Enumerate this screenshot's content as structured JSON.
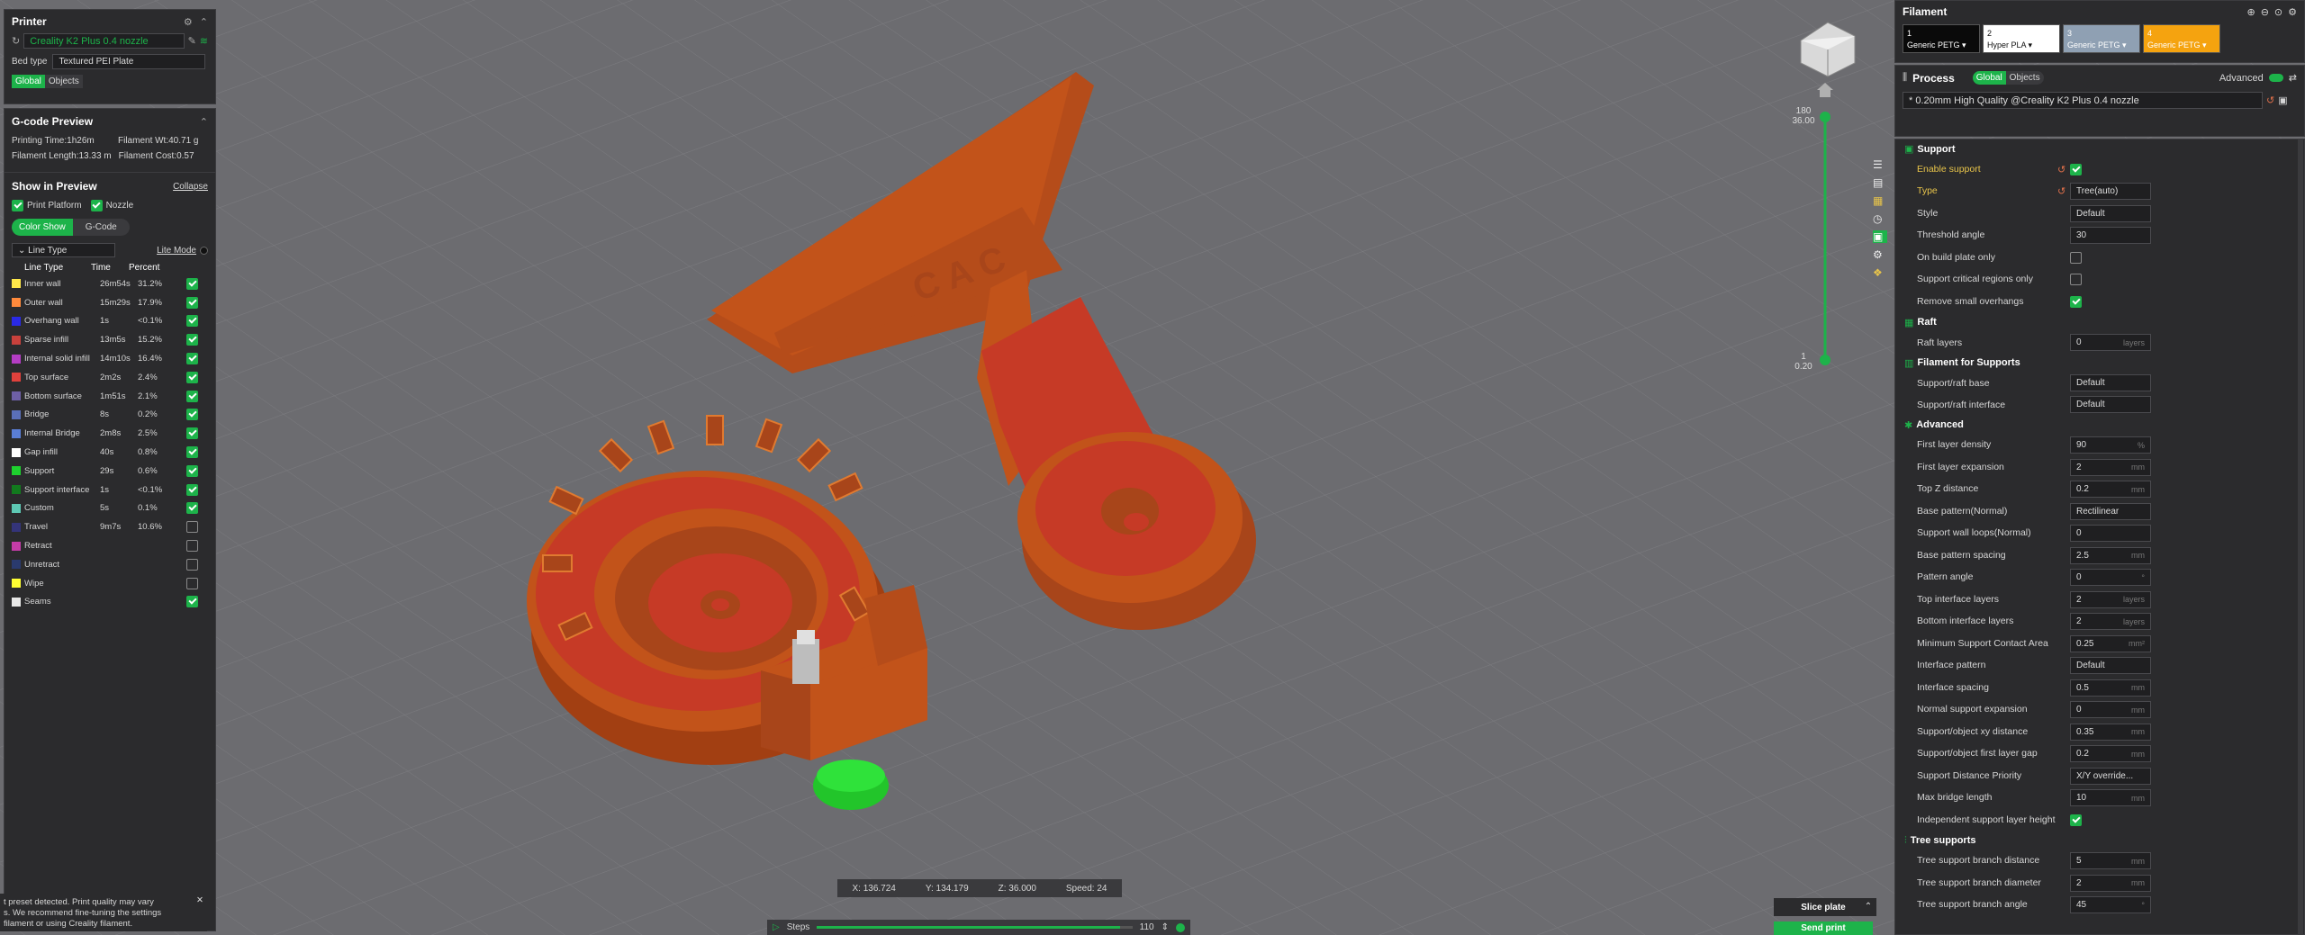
{
  "printer": {
    "title": "Printer",
    "name": "Creality K2 Plus 0.4 nozzle",
    "bed_type_label": "Bed type",
    "bed_type": "Textured PEI Plate",
    "tabs": [
      "Global",
      "Objects"
    ]
  },
  "gcode": {
    "title": "G-code Preview",
    "printing_time": "Printing Time:1h26m",
    "filament_wt": "Filament Wt:40.71 g",
    "filament_length": "Filament Length:13.33 m",
    "filament_cost": "Filament Cost:0.57",
    "show_title": "Show in Preview",
    "collapse": "Collapse",
    "print_platform": "Print Platform",
    "nozzle": "Nozzle",
    "color_show": "Color Show",
    "gcode_btn": "G-Code",
    "line_type_select": "Line Type",
    "lite_mode": "Lite Mode",
    "headers": [
      "Line Type",
      "Time",
      "Percent"
    ],
    "rows": [
      {
        "color": "#ffe84a",
        "name": "Inner wall",
        "time": "26m54s",
        "percent": "31.2%",
        "checked": true
      },
      {
        "color": "#ff8a3c",
        "name": "Outer wall",
        "time": "15m29s",
        "percent": "17.9%",
        "checked": true
      },
      {
        "color": "#2a2ae6",
        "name": "Overhang wall",
        "time": "1s",
        "percent": "<0.1%",
        "checked": true
      },
      {
        "color": "#c8413c",
        "name": "Sparse infill",
        "time": "13m5s",
        "percent": "15.2%",
        "checked": true
      },
      {
        "color": "#b43dc4",
        "name": "Internal solid infill",
        "time": "14m10s",
        "percent": "16.4%",
        "checked": true
      },
      {
        "color": "#e0413c",
        "name": "Top surface",
        "time": "2m2s",
        "percent": "2.4%",
        "checked": true
      },
      {
        "color": "#6e5fa6",
        "name": "Bottom surface",
        "time": "1m51s",
        "percent": "2.1%",
        "checked": true
      },
      {
        "color": "#5a6fb8",
        "name": "Bridge",
        "time": "8s",
        "percent": "0.2%",
        "checked": true
      },
      {
        "color": "#5a7ed6",
        "name": "Internal Bridge",
        "time": "2m8s",
        "percent": "2.5%",
        "checked": true
      },
      {
        "color": "#ffffff",
        "name": "Gap infill",
        "time": "40s",
        "percent": "0.8%",
        "checked": true
      },
      {
        "color": "#1ed12e",
        "name": "Support",
        "time": "29s",
        "percent": "0.6%",
        "checked": true
      },
      {
        "color": "#127a1e",
        "name": "Support interface",
        "time": "1s",
        "percent": "<0.1%",
        "checked": true
      },
      {
        "color": "#5ec8b4",
        "name": "Custom",
        "time": "5s",
        "percent": "0.1%",
        "checked": true
      },
      {
        "color": "#34347a",
        "name": "Travel",
        "time": "9m7s",
        "percent": "10.6%",
        "checked": false
      },
      {
        "color": "#c43ca8",
        "name": "Retract",
        "time": "",
        "percent": "",
        "checked": false
      },
      {
        "color": "#2a3a6e",
        "name": "Unretract",
        "time": "",
        "percent": "",
        "checked": false
      },
      {
        "color": "#ffff33",
        "name": "Wipe",
        "time": "",
        "percent": "",
        "checked": false
      },
      {
        "color": "#e8e8e8",
        "name": "Seams",
        "time": "",
        "percent": "",
        "checked": true
      }
    ]
  },
  "notice": {
    "line1": "t preset detected. Print quality may vary",
    "line2": "s. We recommend fine-tuning the settings",
    "line3": "filament or using Creality filament."
  },
  "status_bar": {
    "x": "X: 136.724",
    "y": "Y: 134.179",
    "z": "Z: 36.000",
    "speed": "Speed: 24"
  },
  "steps": {
    "label": "Steps",
    "value": "110",
    "fraction": 0.96
  },
  "layer_slider": {
    "top_layer": "180",
    "top_height": "36.00",
    "bottom_layer": "1",
    "bottom_height": "0.20"
  },
  "filament": {
    "title": "Filament",
    "slots": [
      {
        "num": "1",
        "name": "Generic PETG",
        "bg": "#0a0a0a",
        "fg": "#ffffff"
      },
      {
        "num": "2",
        "name": "Hyper PLA",
        "bg": "#ffffff",
        "fg": "#111111"
      },
      {
        "num": "3",
        "name": "Generic PETG",
        "bg": "#8fa0b3",
        "fg": "#ffffff"
      },
      {
        "num": "4",
        "name": "Generic PETG",
        "bg": "#f5a30f",
        "fg": "#ffffff"
      }
    ]
  },
  "process": {
    "title": "Process",
    "tabs": [
      "Global",
      "Objects"
    ],
    "advanced": "Advanced",
    "preset": "* 0.20mm High Quality @Creality K2 Plus 0.4 nozzle"
  },
  "settings": {
    "support_title": "Support",
    "enable_support": "Enable support",
    "type_label": "Type",
    "type_value": "Tree(auto)",
    "style_label": "Style",
    "style_value": "Default",
    "threshold_label": "Threshold angle",
    "threshold_value": "30",
    "build_plate_only": "On build plate only",
    "critical_only": "Support critical regions only",
    "remove_small": "Remove small overhangs",
    "raft_title": "Raft",
    "raft_layers": "Raft layers",
    "raft_layers_value": "0",
    "raft_layers_unit": "layers",
    "fil_supports_title": "Filament for Supports",
    "raft_base": "Support/raft base",
    "raft_base_value": "Default",
    "raft_interface": "Support/raft interface",
    "raft_interface_value": "Default",
    "advanced_title": "Advanced",
    "adv_rows": [
      {
        "label": "First layer density",
        "value": "90",
        "unit": "%"
      },
      {
        "label": "First layer expansion",
        "value": "2",
        "unit": "mm"
      },
      {
        "label": "Top Z distance",
        "value": "0.2",
        "unit": "mm"
      },
      {
        "label": "Base pattern(Normal)",
        "value": "Rectilinear",
        "unit": ""
      },
      {
        "label": "Support wall loops(Normal)",
        "value": "0",
        "unit": ""
      },
      {
        "label": "Base pattern spacing",
        "value": "2.5",
        "unit": "mm"
      },
      {
        "label": "Pattern angle",
        "value": "0",
        "unit": "°"
      },
      {
        "label": "Top interface layers",
        "value": "2",
        "unit": "layers"
      },
      {
        "label": "Bottom interface layers",
        "value": "2",
        "unit": "layers"
      },
      {
        "label": "Minimum Support Contact Area",
        "value": "0.25",
        "unit": "mm²"
      },
      {
        "label": "Interface pattern",
        "value": "Default",
        "unit": ""
      },
      {
        "label": "Interface spacing",
        "value": "0.5",
        "unit": "mm"
      },
      {
        "label": "Normal support expansion",
        "value": "0",
        "unit": "mm"
      },
      {
        "label": "Support/object xy distance",
        "value": "0.35",
        "unit": "mm"
      },
      {
        "label": "Support/object first layer gap",
        "value": "0.2",
        "unit": "mm"
      },
      {
        "label": "Support Distance Priority",
        "value": "X/Y override...",
        "unit": ""
      },
      {
        "label": "Max bridge length",
        "value": "10",
        "unit": "mm"
      },
      {
        "label": "Independent support layer height",
        "value": "",
        "unit": ""
      }
    ],
    "tree_title": "Tree supports",
    "tree_rows": [
      {
        "label": "Tree support branch distance",
        "value": "5",
        "unit": "mm"
      },
      {
        "label": "Tree support branch diameter",
        "value": "2",
        "unit": "mm"
      },
      {
        "label": "Tree support branch angle",
        "value": "45",
        "unit": "°"
      }
    ]
  },
  "slice": {
    "slice_plate": "Slice plate",
    "send_print": "Send print"
  }
}
